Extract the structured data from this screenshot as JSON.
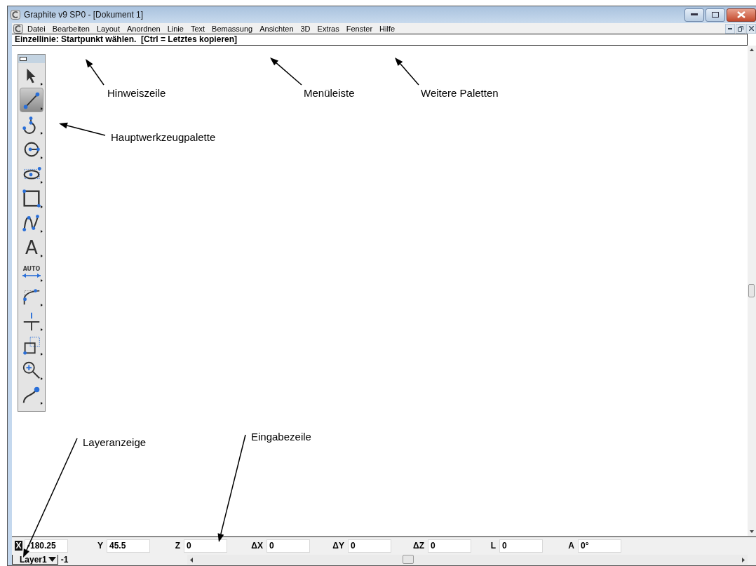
{
  "window": {
    "title": "Graphite v9 SP0 - [Dokument 1]"
  },
  "menu": [
    "Datei",
    "Bearbeiten",
    "Layout",
    "Anordnen",
    "Linie",
    "Text",
    "Bemassung",
    "Ansichten",
    "3D",
    "Extras",
    "Fenster",
    "Hilfe"
  ],
  "hint_line": "Einzellinie: Startpunkt wählen.  [Ctrl = Letztes kopieren]",
  "tools": [
    {
      "kind": "pointer",
      "selected": false
    },
    {
      "kind": "line",
      "selected": true
    },
    {
      "kind": "arc",
      "selected": false
    },
    {
      "kind": "circle",
      "selected": false
    },
    {
      "kind": "ellipse",
      "selected": false
    },
    {
      "kind": "rectangle",
      "selected": false
    },
    {
      "kind": "spline",
      "selected": false
    },
    {
      "kind": "text",
      "label": "A",
      "selected": false
    },
    {
      "kind": "dimension",
      "label": "AUTO",
      "selected": false
    },
    {
      "kind": "fillet",
      "selected": false
    },
    {
      "kind": "cross",
      "selected": false
    },
    {
      "kind": "squares",
      "selected": false
    },
    {
      "kind": "zoom",
      "selected": false
    },
    {
      "kind": "curve",
      "selected": false
    }
  ],
  "annotations": [
    {
      "label": "Hinweiszeile"
    },
    {
      "label": "Menüleiste"
    },
    {
      "label": "Weitere Paletten"
    },
    {
      "label": "Hauptwerkzeugpalette"
    },
    {
      "label": "Layeranzeige"
    },
    {
      "label": "Eingabezeile"
    }
  ],
  "input_line": [
    {
      "label": "X",
      "kind": "inverted",
      "value": "-180.25"
    },
    {
      "label": "Y",
      "value": "45.5"
    },
    {
      "label": "Z",
      "value": "0"
    },
    {
      "label": "ΔX",
      "value": "0"
    },
    {
      "label": "ΔY",
      "value": "0"
    },
    {
      "label": "ΔZ",
      "value": "0"
    },
    {
      "label": "L",
      "value": "0"
    },
    {
      "label": "A",
      "value": "0°"
    }
  ],
  "layer": {
    "name": "Layer1",
    "value": "-1"
  }
}
